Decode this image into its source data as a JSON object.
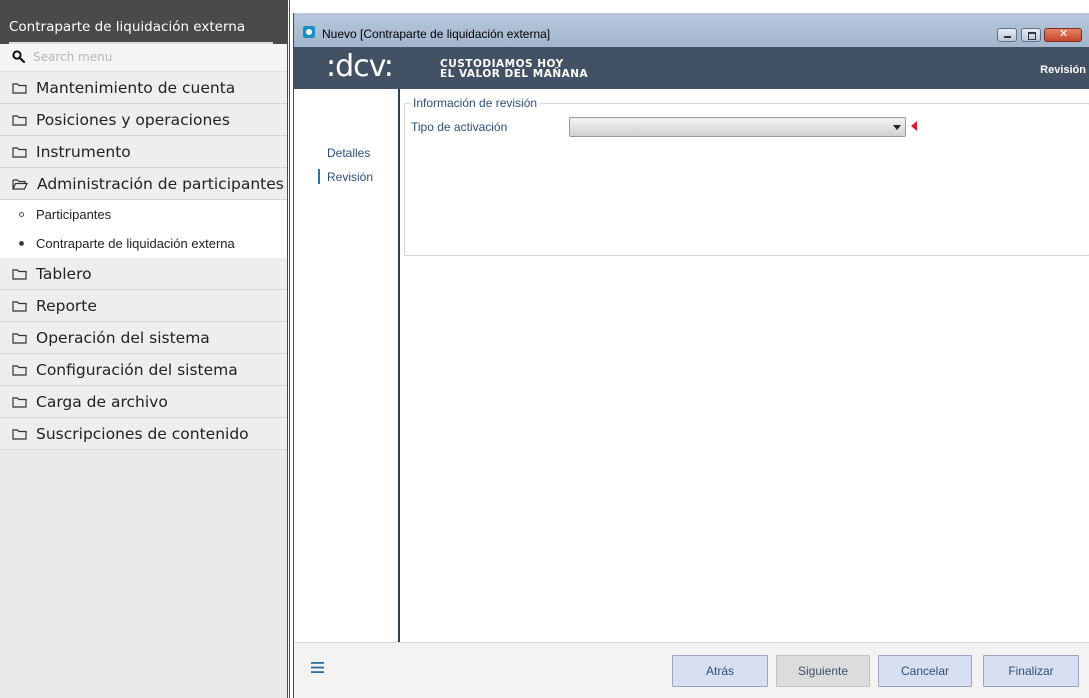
{
  "sidebar": {
    "title": "Contraparte de liquidación externa",
    "search_placeholder": "Search menu",
    "items": [
      {
        "label": "Mantenimiento de cuenta"
      },
      {
        "label": "Posiciones y operaciones"
      },
      {
        "label": "Instrumento"
      },
      {
        "label": "Administración de participantes"
      },
      {
        "label": "Tablero"
      },
      {
        "label": "Reporte"
      },
      {
        "label": "Operación del sistema"
      },
      {
        "label": "Configuración del sistema"
      },
      {
        "label": "Carga de archivo"
      },
      {
        "label": "Suscripciones de contenido"
      }
    ],
    "sub_items": [
      {
        "label": "Participantes",
        "selected": false
      },
      {
        "label": "Contraparte de liquidación externa",
        "selected": true
      }
    ]
  },
  "window": {
    "title": "Nuevo [Contraparte de liquidación externa]",
    "controls": {
      "minimize": "minimize-icon",
      "maximize": "maximize-icon",
      "close": "close-icon"
    }
  },
  "brand": {
    "logo": ":dcv:",
    "slogan_line1": "CUSTODIAMOS HOY",
    "slogan_line2": "EL VALOR DEL MAÑANA",
    "current_step": "Revisión"
  },
  "wizard": {
    "steps": [
      "Detalles",
      "Revisión"
    ],
    "active_step": "Revisión",
    "section_title": "Información de revisión",
    "field_label": "Tipo de activación",
    "field_value": ""
  },
  "footer": {
    "back_label": "Atrás",
    "next_label": "Siguiente",
    "cancel_label": "Cancelar",
    "finish_label": "Finalizar"
  },
  "colors": {
    "brand_bar": "#425164",
    "link_text": "#2d4f7c",
    "required_marker": "#d01f2a",
    "active_step_marker": "#1d7ab4"
  }
}
